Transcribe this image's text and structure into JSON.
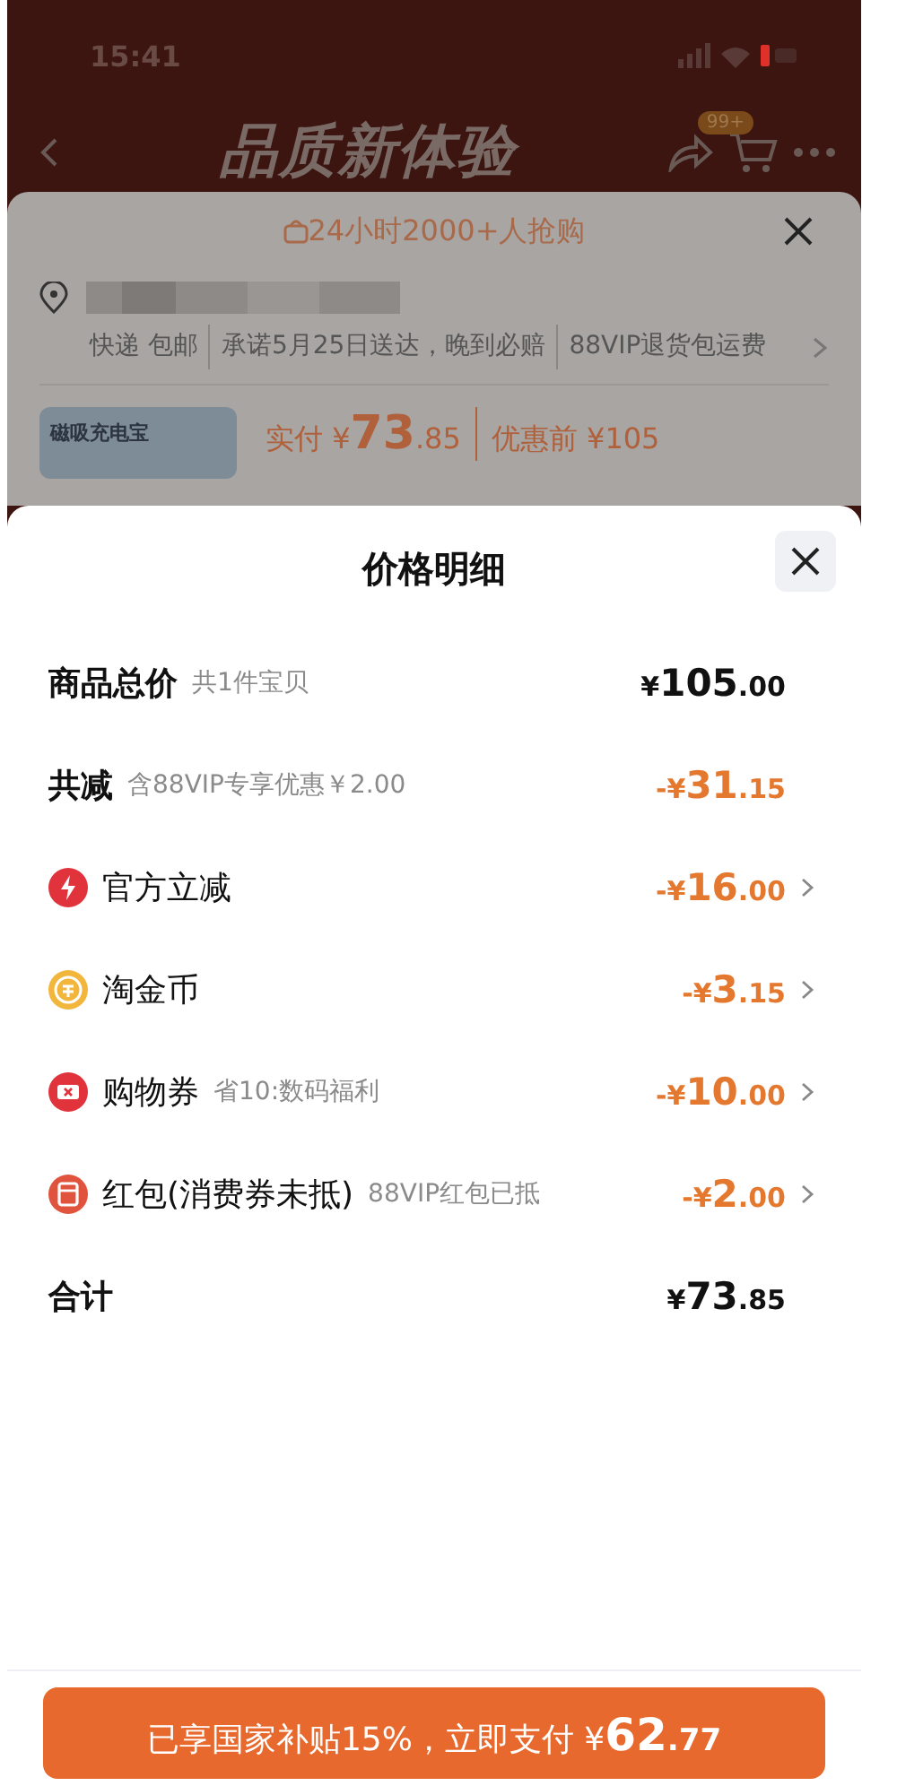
{
  "status_bar": {
    "time": "15:41"
  },
  "header": {
    "banner": "品质新体验",
    "cart_badge": "99+"
  },
  "background_sheet": {
    "promo": "24小时2000+人抢购",
    "shipping": [
      "快递 包邮",
      "承诺5月25日送达，晚到必赔",
      "88VIP退货包运费"
    ],
    "product_tag": "磁吸充电宝",
    "price_label": "实付",
    "price_currency": "¥",
    "price_integer": "73",
    "price_decimal": ".85",
    "original_price": "优惠前 ¥105"
  },
  "sheet": {
    "title": "价格明细",
    "rows": [
      {
        "kind": "total",
        "label": "商品总价",
        "note": "共1件宝贝",
        "prefix": "¥",
        "integer": "105",
        "decimal": ".00",
        "expandable": false
      },
      {
        "kind": "reduction",
        "label": "共减",
        "note": "含88VIP专享优惠￥2.00",
        "prefix": "-¥",
        "integer": "31",
        "decimal": ".15",
        "expandable": false
      },
      {
        "kind": "item",
        "label": "官方立减",
        "prefix": "-¥",
        "integer": "16",
        "decimal": ".00",
        "expandable": true
      },
      {
        "kind": "item",
        "label": "淘金币",
        "prefix": "-¥",
        "integer": "3",
        "decimal": ".15",
        "expandable": true
      },
      {
        "kind": "item",
        "label": "购物券",
        "note": "省10:数码福利",
        "prefix": "-¥",
        "integer": "10",
        "decimal": ".00",
        "expandable": true
      },
      {
        "kind": "item",
        "label": "红包(消费券未抵)",
        "note": "88VIP红包已抵",
        "prefix": "-¥",
        "integer": "2",
        "decimal": ".00",
        "expandable": true
      },
      {
        "kind": "total",
        "label": "合计",
        "prefix": "¥",
        "integer": "73",
        "decimal": ".85",
        "expandable": false
      }
    ]
  },
  "pay_button": {
    "text": "已享国家补贴15%，立即支付 ¥",
    "integer": "62",
    "decimal": ".77"
  }
}
